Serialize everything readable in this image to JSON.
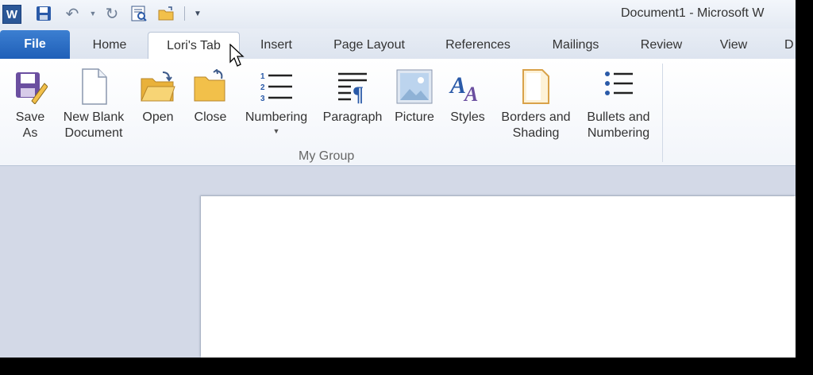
{
  "quick_access": {
    "app_icon_letter": "W",
    "icons": [
      "word-logo-icon",
      "save-icon",
      "undo-icon",
      "dropdown-icon",
      "redo-icon",
      "print-preview-icon",
      "open-folder-icon",
      "customize-toolbar-icon"
    ]
  },
  "window": {
    "title": "Document1  -  Microsoft W"
  },
  "tabs": [
    {
      "label": "File"
    },
    {
      "label": "Home"
    },
    {
      "label": "Lori's Tab"
    },
    {
      "label": "Insert"
    },
    {
      "label": "Page Layout"
    },
    {
      "label": "References"
    },
    {
      "label": "Mailings"
    },
    {
      "label": "Review"
    },
    {
      "label": "View"
    },
    {
      "label": "D"
    }
  ],
  "active_tab": "Lori's Tab",
  "ribbon": {
    "group_label": "My Group",
    "buttons": [
      {
        "line1": "Save",
        "line2": "As",
        "icon": "save-as-icon"
      },
      {
        "line1": "New Blank",
        "line2": "Document",
        "icon": "new-document-icon"
      },
      {
        "line1": "Open",
        "line2": "",
        "icon": "open-folder-icon"
      },
      {
        "line1": "Close",
        "line2": "",
        "icon": "close-folder-icon"
      },
      {
        "line1": "Numbering",
        "line2": "",
        "icon": "numbering-icon",
        "dropdown": true
      },
      {
        "line1": "Paragraph",
        "line2": "",
        "icon": "paragraph-icon"
      },
      {
        "line1": "Picture",
        "line2": "",
        "icon": "picture-icon"
      },
      {
        "line1": "Styles",
        "line2": "",
        "icon": "styles-icon"
      },
      {
        "line1": "Borders and",
        "line2": "Shading",
        "icon": "borders-shading-icon"
      },
      {
        "line1": "Bullets and",
        "line2": "Numbering",
        "icon": "bullets-icon"
      }
    ]
  },
  "colors": {
    "file_tab": "#2a6bc4",
    "ribbon_bg": "#ffffff",
    "workspace": "#d3d9e7"
  }
}
